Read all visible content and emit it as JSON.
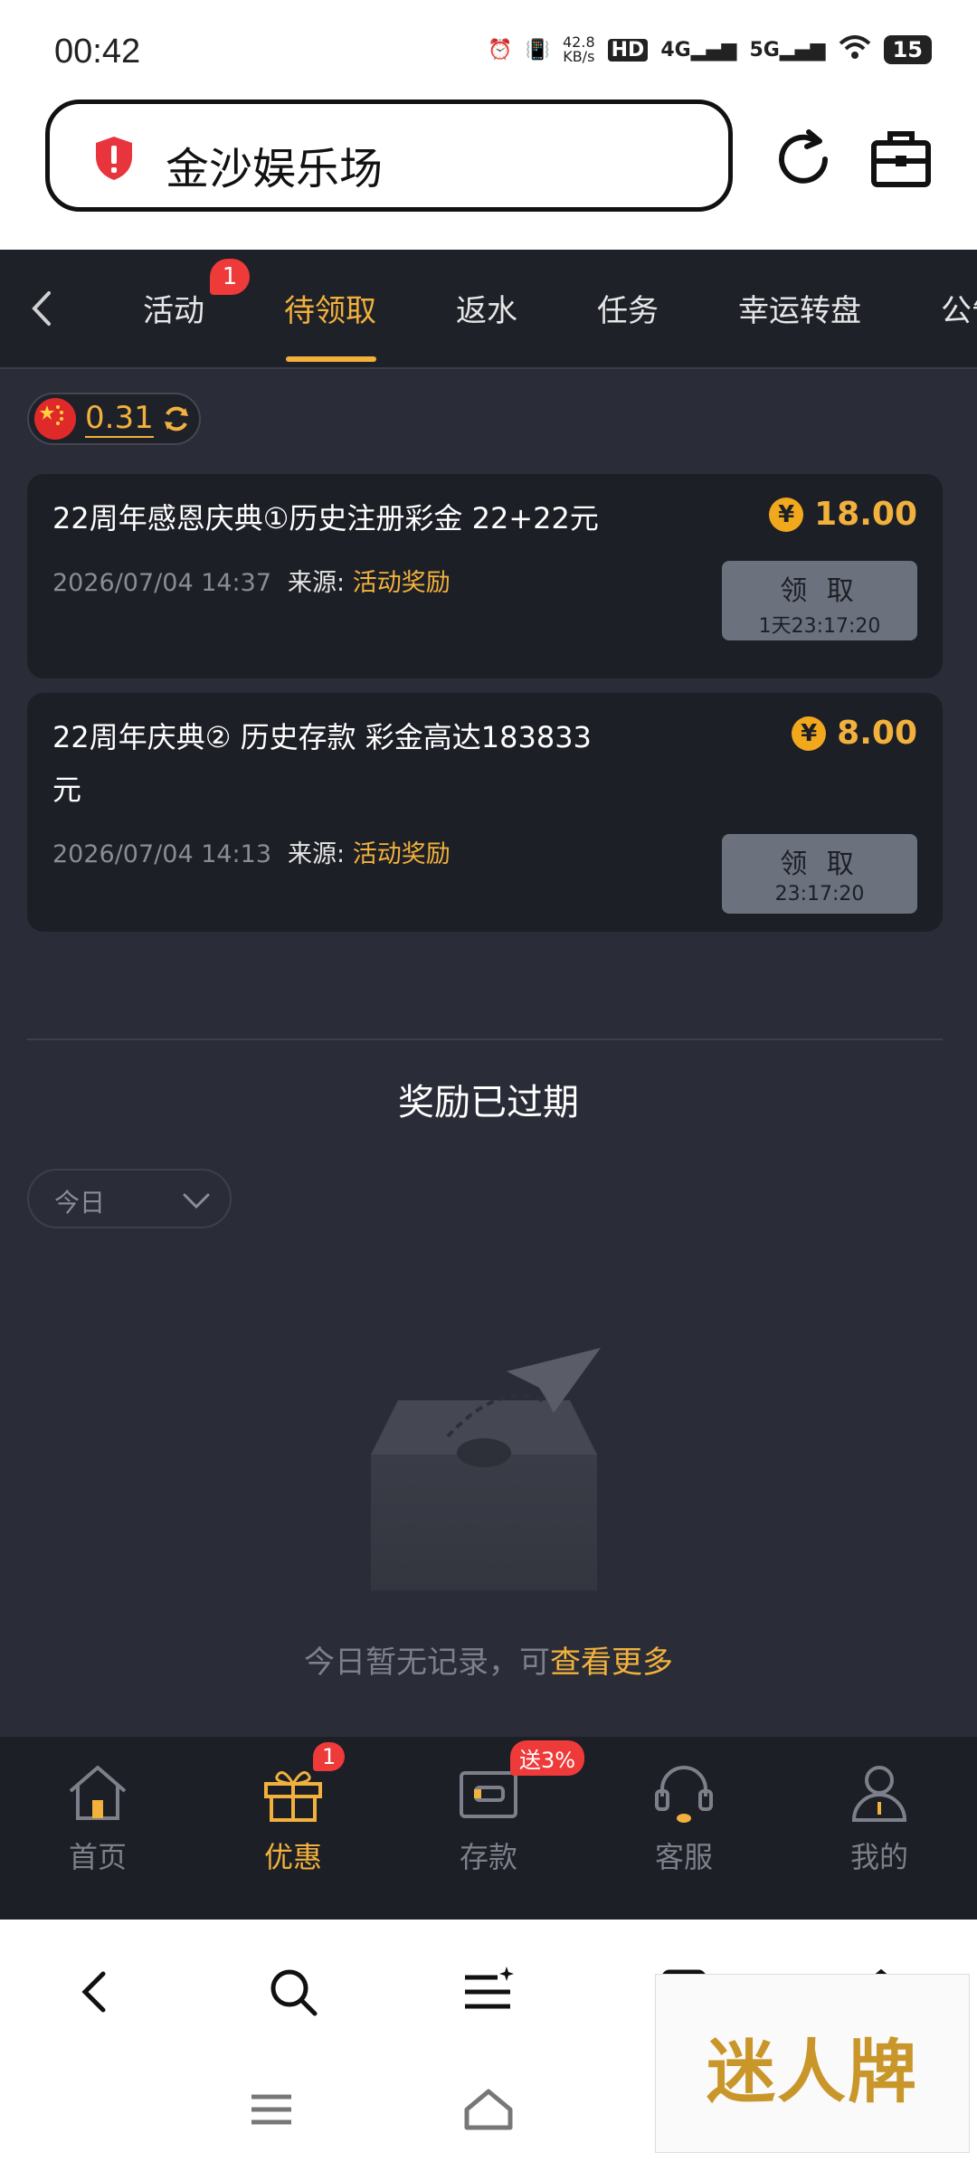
{
  "status_bar": {
    "time": "00:42",
    "net_speed_value": "42.8",
    "net_speed_unit": "KB/s",
    "hd": "HD",
    "sim_4g": "4G",
    "sim_5g": "5G",
    "battery": "15"
  },
  "browser": {
    "url_title": "金沙娱乐场"
  },
  "tabs": [
    {
      "label": "活动"
    },
    {
      "label": "待领取"
    },
    {
      "label": "返水"
    },
    {
      "label": "任务"
    },
    {
      "label": "幸运转盘"
    },
    {
      "label": "公告"
    }
  ],
  "tab_badge": "1",
  "balance": "0.31",
  "rewards": [
    {
      "title": "22周年感恩庆典①历史注册彩金 22+22元",
      "amount": "18.00",
      "currency_icon": "¥",
      "date": "2026/07/04 14:37",
      "source_label": "来源:",
      "source_value": "活动奖励",
      "claim_label": "领 取",
      "timer": "1天23:17:20"
    },
    {
      "title_line1": "22周年庆典② 历史存款 彩金高达183833",
      "title_line2": "元",
      "amount": "8.00",
      "currency_icon": "¥",
      "date": "2026/07/04 14:13",
      "source_label": "来源:",
      "source_value": "活动奖励",
      "claim_label": "领 取",
      "timer": "23:17:20"
    }
  ],
  "expired": {
    "title": "奖励已过期",
    "filter_value": "今日",
    "empty_text": "今日暂无记录，可",
    "empty_link": "查看更多"
  },
  "bottom_nav": [
    {
      "label": "首页"
    },
    {
      "label": "优惠",
      "badge": "1"
    },
    {
      "label": "存款",
      "badge": "送3%"
    },
    {
      "label": "客服"
    },
    {
      "label": "我的"
    }
  ],
  "watermark": "迷人牌",
  "colors": {
    "accent": "#f2b13c",
    "badge": "#ef3a3a",
    "app_bg": "#2a2d37",
    "card_bg": "#1d1f26"
  }
}
